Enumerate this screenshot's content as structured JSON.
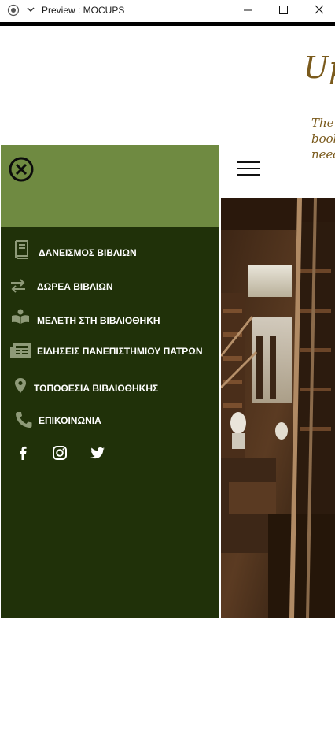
{
  "window": {
    "title": "Preview : MOCUPS",
    "controls": [
      "minimize",
      "maximize",
      "close"
    ]
  },
  "page": {
    "heading": "Up",
    "subtitle_lines": [
      "The",
      "book",
      "need"
    ]
  },
  "menu": {
    "items": [
      {
        "label": "ΔΑΝΕΙΣΜΟΣ ΒΙΒΛΙΩΝ",
        "icon": "book-icon"
      },
      {
        "label": "ΔΩΡΕΑ ΒΙΒΛΙΩΝ",
        "icon": "exchange-icon"
      },
      {
        "label": "ΜΕΛΕΤΗ ΣΤΗ ΒΙΒΛΙΟΘΗΚΗ",
        "icon": "reader-icon"
      },
      {
        "label": "ΕΙΔΗΣΕΙΣ ΠΑΝΕΠΙΣΤΗΜΙΟΥ ΠΑΤΡΩΝ",
        "icon": "newspaper-icon"
      },
      {
        "label": "ΤΟΠΟΘΕΣΙΑ ΒΙΒΛΙΟΘΗΚΗΣ",
        "icon": "map-pin-icon"
      },
      {
        "label": "ΕΠΙΚΟΙΝΩΝΙΑ",
        "icon": "phone-icon"
      }
    ],
    "social": [
      "facebook-icon",
      "instagram-icon",
      "twitter-icon"
    ]
  },
  "colors": {
    "menu_header": "#6f8a41",
    "menu_body": "#203109",
    "menu_icon": "#8e9a78",
    "heading_brown": "#7a5a1c"
  }
}
